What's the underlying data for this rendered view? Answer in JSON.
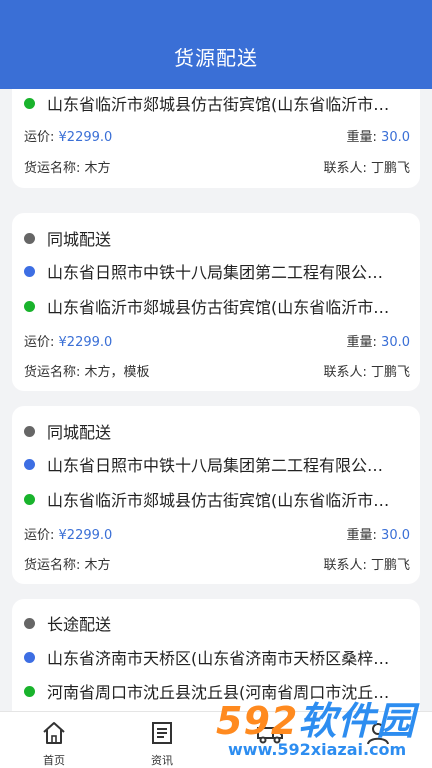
{
  "header": {
    "title": "货源配送"
  },
  "cards": [
    {
      "type": "",
      "from": "",
      "to": "山东省临沂市郯城县仿古街宾馆(山东省临沂市…",
      "price_label": "运价:",
      "price": "¥2299.0",
      "weight_label": "重量:",
      "weight": "30.0",
      "goods_label": "货运名称:",
      "goods": "木方",
      "contact_label": "联系人:",
      "contact": "丁鹏飞"
    },
    {
      "type": "同城配送",
      "from": "山东省日照市中铁十八局集团第二工程有限公…",
      "to": "山东省临沂市郯城县仿古街宾馆(山东省临沂市…",
      "price_label": "运价:",
      "price": "¥2299.0",
      "weight_label": "重量:",
      "weight": "30.0",
      "goods_label": "货运名称:",
      "goods": "木方，模板",
      "contact_label": "联系人:",
      "contact": "丁鹏飞"
    },
    {
      "type": "同城配送",
      "from": "山东省日照市中铁十八局集团第二工程有限公…",
      "to": "山东省临沂市郯城县仿古街宾馆(山东省临沂市…",
      "price_label": "运价:",
      "price": "¥2299.0",
      "weight_label": "重量:",
      "weight": "30.0",
      "goods_label": "货运名称:",
      "goods": "木方",
      "contact_label": "联系人:",
      "contact": "丁鹏飞"
    },
    {
      "type": "长途配送",
      "from": "山东省济南市天桥区(山东省济南市天桥区桑梓…",
      "to": "河南省周口市沈丘县沈丘县(河南省周口市沈丘…"
    }
  ],
  "tabbar": [
    {
      "label": "首页",
      "icon": "home-icon"
    },
    {
      "label": "资讯",
      "icon": "news-icon"
    },
    {
      "label": "",
      "icon": "truck-icon"
    },
    {
      "label": "",
      "icon": "user-icon"
    }
  ],
  "watermark": {
    "text_num": "592",
    "text_cn": "软件园",
    "url": "www.592xiazai.com"
  },
  "colors": {
    "header": "#3a6fd6",
    "accent_value": "#3a6fd6",
    "dot_from": "#3d6ee3",
    "dot_to": "#19b32c",
    "dot_type": "#666666"
  }
}
